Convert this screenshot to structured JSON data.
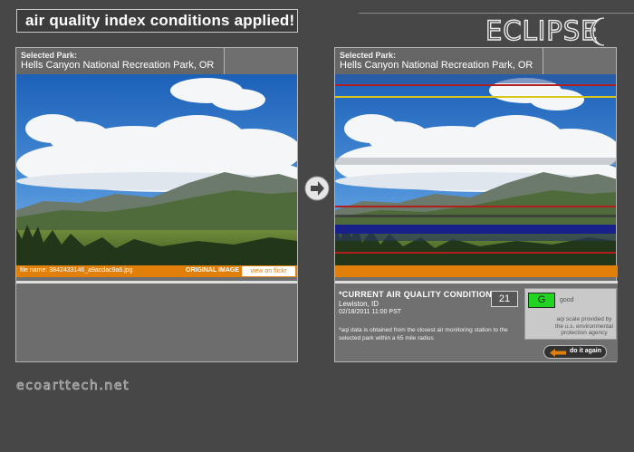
{
  "header": {
    "banner": "air quality index conditions applied!",
    "logo": "ECLIPSE"
  },
  "left_panel": {
    "label": "Selected Park:",
    "park": "Hells Canyon National Recreation Park, OR",
    "filename": "file name: 3842433146_a9acdac9a6.jpg",
    "image_label": "ORIGINAL IMAGE",
    "flickr_button": "view on flickr"
  },
  "right_panel": {
    "label": "Selected Park:",
    "park": "Hells Canyon National Recreation Park, OR",
    "aq_title": "*CURRENT AIR QUALITY CONDITIONS",
    "location": "Lewiston, ID",
    "timestamp": "02/18/2011 11:00 PST",
    "note": "*aqi data is obtained from the closest air monitoring station to the selected park within a 65 mile radius",
    "aqi_value": "21",
    "aqi_grade": "G",
    "aqi_word": "good",
    "aqi_source": "aqi scale provided by the u.s. environmental protection agency",
    "again_button": "do it again"
  },
  "footer": {
    "site": "ecoarttech.net"
  },
  "colors": {
    "accent": "#e0800a",
    "good": "#22d422",
    "background": "#474747"
  },
  "icons": {
    "next": "arrow-right-circle-icon",
    "moon": "crescent-moon-icon",
    "back": "arrow-left-icon"
  }
}
